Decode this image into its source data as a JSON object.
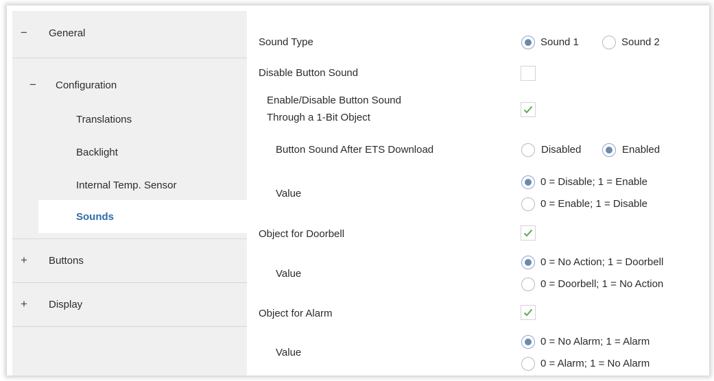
{
  "sidebar": {
    "general": "General",
    "configuration": "Configuration",
    "translations": "Translations",
    "backlight": "Backlight",
    "internal_temp": "Internal Temp. Sensor",
    "sounds": "Sounds",
    "buttons": "Buttons",
    "display": "Display",
    "minus": "−",
    "plus": "+"
  },
  "params": {
    "sound_type": {
      "label": "Sound Type",
      "option1": "Sound 1",
      "option2": "Sound 2",
      "selected": "Sound 1"
    },
    "disable_button_sound": {
      "label": "Disable Button Sound",
      "checked": false
    },
    "enable_disable_1bit": {
      "label_line1": "Enable/Disable Button Sound",
      "label_line2": "Through a 1-Bit Object",
      "checked": true
    },
    "after_ets_download": {
      "label": "Button Sound After ETS Download",
      "option1": "Disabled",
      "option2": "Enabled",
      "selected": "Enabled"
    },
    "value_sound": {
      "label": "Value",
      "option1": "0 = Disable; 1 = Enable",
      "option2": "0 = Enable; 1 = Disable",
      "selected": "0 = Disable; 1 = Enable"
    },
    "object_doorbell": {
      "label": "Object for Doorbell",
      "checked": true
    },
    "value_doorbell": {
      "label": "Value",
      "option1": "0 = No Action; 1 = Doorbell",
      "option2": "0 = Doorbell; 1 = No Action",
      "selected": "0 = No Action; 1 = Doorbell"
    },
    "object_alarm": {
      "label": "Object for Alarm",
      "checked": true
    },
    "value_alarm": {
      "label": "Value",
      "option1": "0 = No Alarm; 1 = Alarm",
      "option2": "0 = Alarm; 1 = No Alarm",
      "selected": "0 = No Alarm; 1 = Alarm"
    }
  },
  "colors": {
    "active_nav": "#2d6ea7",
    "check": "#5aae52",
    "radio_dot": "#6f89ad"
  }
}
